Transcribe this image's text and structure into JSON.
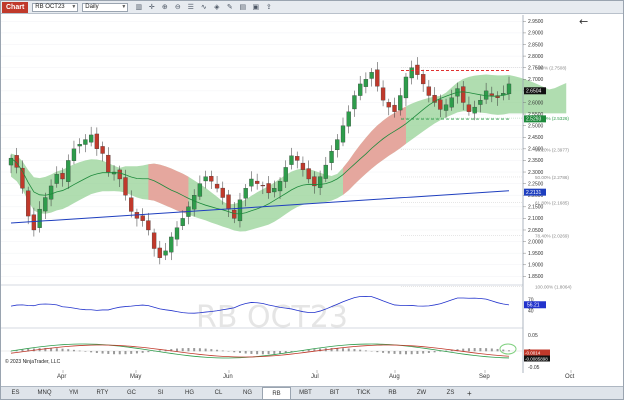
{
  "toolbar": {
    "chart_tag": "Chart",
    "instrument": "RB OCT23",
    "period": "Daily",
    "icons": [
      "bars-icon",
      "crosshair-icon",
      "zoom-in-icon",
      "zoom-out-icon",
      "properties-icon",
      "indicators-icon",
      "strategies-icon",
      "drawing-tools-icon",
      "templates-icon",
      "snapshot-icon",
      "share-icon"
    ]
  },
  "chart": {
    "watermark": "RB OCT23",
    "copyright": "© 2023 NinjaTrader, LLC",
    "back_arrow": "←",
    "price_ticks": [
      "2.9500",
      "2.9000",
      "2.8500",
      "2.8000",
      "2.7500",
      "2.7000",
      "2.6500",
      "2.6000",
      "2.5500",
      "2.5000",
      "2.4500",
      "2.4000",
      "2.3500",
      "2.3000",
      "2.2500",
      "2.2000",
      "2.1500",
      "2.1000",
      "2.0500",
      "2.0000",
      "1.9500",
      "1.9000",
      "1.8500"
    ],
    "price_labels": {
      "last": "2.6504",
      "ma_fast": "2.5293",
      "ma_slow": "2.2131"
    },
    "fib_levels": [
      {
        "label": "0.00% (2.7508)",
        "value": 2.7508,
        "color": "#999999"
      },
      {
        "label": "23.60% (2.5326)",
        "value": 2.5326,
        "color": "#2e9c4b"
      },
      {
        "label": "38.20% (2.3977)",
        "value": 2.3977,
        "color": "#999999"
      },
      {
        "label": "50.00% (2.2786)",
        "value": 2.2786,
        "color": "#999999"
      },
      {
        "label": "61.80% (2.1685)",
        "value": 2.1685,
        "color": "#999999"
      },
      {
        "label": "78.40% (2.0269)",
        "value": 2.0269,
        "color": "#999999"
      },
      {
        "label": "100.00% (1.8064)",
        "value": 1.8064,
        "color": "#999999"
      }
    ],
    "resistance_level": 2.7508,
    "support_level": 2.5326,
    "rsi_ticks": [
      "70",
      "50",
      "40"
    ],
    "rsi_label": "56.21",
    "macd_ticks": [
      "0.05",
      "0",
      "-0.05"
    ],
    "macd_labels": [
      "-0.0014",
      "-0.0085898"
    ],
    "date_labels": [
      "Apr",
      "May",
      "Jun",
      "Jul",
      "Aug",
      "Sep",
      "Oct"
    ]
  },
  "chart_data": {
    "type": "candlestick",
    "instrument": "RB OCT23",
    "interval": "Daily",
    "ylim": [
      1.83,
      2.96
    ],
    "x_range": [
      "Mar 2023",
      "Oct 2023"
    ],
    "ohlc_close": [
      2.36,
      2.32,
      2.23,
      2.11,
      2.05,
      2.14,
      2.19,
      2.24,
      2.29,
      2.27,
      2.35,
      2.4,
      2.42,
      2.44,
      2.46,
      2.4,
      2.38,
      2.3,
      2.3,
      2.27,
      2.2,
      2.13,
      2.1,
      2.09,
      2.05,
      1.97,
      1.93,
      1.96,
      2.02,
      2.06,
      2.1,
      2.15,
      2.2,
      2.25,
      2.28,
      2.26,
      2.23,
      2.19,
      2.14,
      2.1,
      2.18,
      2.23,
      2.27,
      2.25,
      2.24,
      2.21,
      2.23,
      2.26,
      2.32,
      2.37,
      2.35,
      2.31,
      2.27,
      2.24,
      2.28,
      2.33,
      2.39,
      2.44,
      2.5,
      2.56,
      2.63,
      2.68,
      2.7,
      2.73,
      2.67,
      2.61,
      2.58,
      2.56,
      2.63,
      2.71,
      2.75,
      2.72,
      2.68,
      2.63,
      2.6,
      2.57,
      2.59,
      2.62,
      2.66,
      2.6,
      2.56,
      2.58,
      2.61,
      2.65,
      2.63,
      2.62,
      2.64,
      2.68
    ],
    "indicators": [
      "Ichimoku Cloud",
      "SMA 50",
      "SMA 200",
      "Fibonacci Retracement",
      "RSI",
      "MACD"
    ],
    "rsi_last": 56.21
  },
  "tabs": [
    "ES",
    "MNQ",
    "YM",
    "RTY",
    "GC",
    "SI",
    "HG",
    "CL",
    "NG",
    "RB",
    "MBT",
    "BIT",
    "TICK",
    "RB",
    "ZW",
    "ZS",
    "+"
  ],
  "active_tab_index": 9
}
